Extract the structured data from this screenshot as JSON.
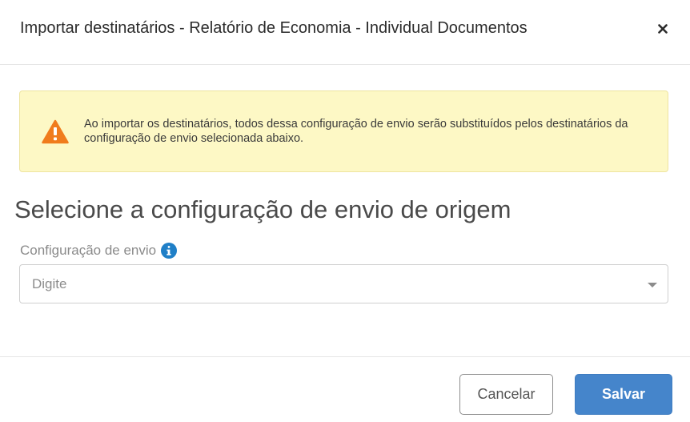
{
  "modal": {
    "title": "Importar destinatários - Relatório de Economia - Individual Documentos",
    "close_icon": "close-icon"
  },
  "warning": {
    "icon": "warning-triangle-icon",
    "text": "Ao importar os destinatários, todos dessa configuração de envio serão substituídos pelos destinatários da configuração de envio selecionada abaixo."
  },
  "section": {
    "title": "Selecione a configuração de envio de origem"
  },
  "field": {
    "label": "Configuração de envio",
    "info_icon": "info-icon",
    "placeholder": "Digite",
    "caret_icon": "caret-down-icon"
  },
  "footer": {
    "cancel_label": "Cancelar",
    "save_label": "Salvar"
  },
  "colors": {
    "warning_bg": "#fdf8c5",
    "warning_icon": "#f07c1d",
    "info_icon": "#1f7fc7",
    "primary": "#4585cb"
  }
}
